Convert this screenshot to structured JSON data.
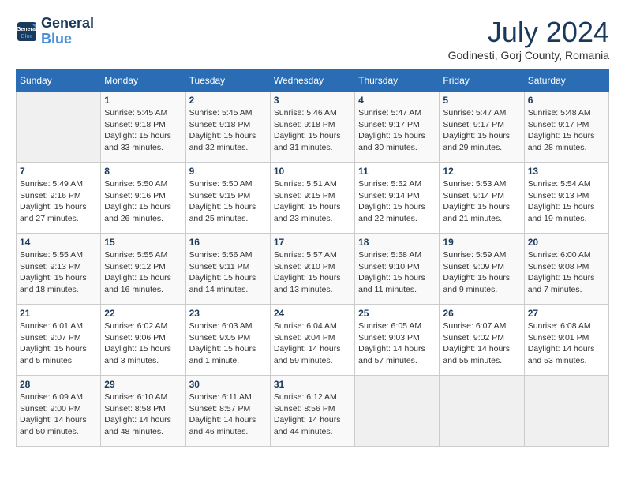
{
  "header": {
    "logo_line1": "General",
    "logo_line2": "Blue",
    "month_title": "July 2024",
    "location": "Godinesti, Gorj County, Romania"
  },
  "weekdays": [
    "Sunday",
    "Monday",
    "Tuesday",
    "Wednesday",
    "Thursday",
    "Friday",
    "Saturday"
  ],
  "weeks": [
    [
      {
        "day": "",
        "info": ""
      },
      {
        "day": "1",
        "info": "Sunrise: 5:45 AM\nSunset: 9:18 PM\nDaylight: 15 hours\nand 33 minutes."
      },
      {
        "day": "2",
        "info": "Sunrise: 5:45 AM\nSunset: 9:18 PM\nDaylight: 15 hours\nand 32 minutes."
      },
      {
        "day": "3",
        "info": "Sunrise: 5:46 AM\nSunset: 9:18 PM\nDaylight: 15 hours\nand 31 minutes."
      },
      {
        "day": "4",
        "info": "Sunrise: 5:47 AM\nSunset: 9:17 PM\nDaylight: 15 hours\nand 30 minutes."
      },
      {
        "day": "5",
        "info": "Sunrise: 5:47 AM\nSunset: 9:17 PM\nDaylight: 15 hours\nand 29 minutes."
      },
      {
        "day": "6",
        "info": "Sunrise: 5:48 AM\nSunset: 9:17 PM\nDaylight: 15 hours\nand 28 minutes."
      }
    ],
    [
      {
        "day": "7",
        "info": "Sunrise: 5:49 AM\nSunset: 9:16 PM\nDaylight: 15 hours\nand 27 minutes."
      },
      {
        "day": "8",
        "info": "Sunrise: 5:50 AM\nSunset: 9:16 PM\nDaylight: 15 hours\nand 26 minutes."
      },
      {
        "day": "9",
        "info": "Sunrise: 5:50 AM\nSunset: 9:15 PM\nDaylight: 15 hours\nand 25 minutes."
      },
      {
        "day": "10",
        "info": "Sunrise: 5:51 AM\nSunset: 9:15 PM\nDaylight: 15 hours\nand 23 minutes."
      },
      {
        "day": "11",
        "info": "Sunrise: 5:52 AM\nSunset: 9:14 PM\nDaylight: 15 hours\nand 22 minutes."
      },
      {
        "day": "12",
        "info": "Sunrise: 5:53 AM\nSunset: 9:14 PM\nDaylight: 15 hours\nand 21 minutes."
      },
      {
        "day": "13",
        "info": "Sunrise: 5:54 AM\nSunset: 9:13 PM\nDaylight: 15 hours\nand 19 minutes."
      }
    ],
    [
      {
        "day": "14",
        "info": "Sunrise: 5:55 AM\nSunset: 9:13 PM\nDaylight: 15 hours\nand 18 minutes."
      },
      {
        "day": "15",
        "info": "Sunrise: 5:55 AM\nSunset: 9:12 PM\nDaylight: 15 hours\nand 16 minutes."
      },
      {
        "day": "16",
        "info": "Sunrise: 5:56 AM\nSunset: 9:11 PM\nDaylight: 15 hours\nand 14 minutes."
      },
      {
        "day": "17",
        "info": "Sunrise: 5:57 AM\nSunset: 9:10 PM\nDaylight: 15 hours\nand 13 minutes."
      },
      {
        "day": "18",
        "info": "Sunrise: 5:58 AM\nSunset: 9:10 PM\nDaylight: 15 hours\nand 11 minutes."
      },
      {
        "day": "19",
        "info": "Sunrise: 5:59 AM\nSunset: 9:09 PM\nDaylight: 15 hours\nand 9 minutes."
      },
      {
        "day": "20",
        "info": "Sunrise: 6:00 AM\nSunset: 9:08 PM\nDaylight: 15 hours\nand 7 minutes."
      }
    ],
    [
      {
        "day": "21",
        "info": "Sunrise: 6:01 AM\nSunset: 9:07 PM\nDaylight: 15 hours\nand 5 minutes."
      },
      {
        "day": "22",
        "info": "Sunrise: 6:02 AM\nSunset: 9:06 PM\nDaylight: 15 hours\nand 3 minutes."
      },
      {
        "day": "23",
        "info": "Sunrise: 6:03 AM\nSunset: 9:05 PM\nDaylight: 15 hours\nand 1 minute."
      },
      {
        "day": "24",
        "info": "Sunrise: 6:04 AM\nSunset: 9:04 PM\nDaylight: 14 hours\nand 59 minutes."
      },
      {
        "day": "25",
        "info": "Sunrise: 6:05 AM\nSunset: 9:03 PM\nDaylight: 14 hours\nand 57 minutes."
      },
      {
        "day": "26",
        "info": "Sunrise: 6:07 AM\nSunset: 9:02 PM\nDaylight: 14 hours\nand 55 minutes."
      },
      {
        "day": "27",
        "info": "Sunrise: 6:08 AM\nSunset: 9:01 PM\nDaylight: 14 hours\nand 53 minutes."
      }
    ],
    [
      {
        "day": "28",
        "info": "Sunrise: 6:09 AM\nSunset: 9:00 PM\nDaylight: 14 hours\nand 50 minutes."
      },
      {
        "day": "29",
        "info": "Sunrise: 6:10 AM\nSunset: 8:58 PM\nDaylight: 14 hours\nand 48 minutes."
      },
      {
        "day": "30",
        "info": "Sunrise: 6:11 AM\nSunset: 8:57 PM\nDaylight: 14 hours\nand 46 minutes."
      },
      {
        "day": "31",
        "info": "Sunrise: 6:12 AM\nSunset: 8:56 PM\nDaylight: 14 hours\nand 44 minutes."
      },
      {
        "day": "",
        "info": ""
      },
      {
        "day": "",
        "info": ""
      },
      {
        "day": "",
        "info": ""
      }
    ]
  ]
}
